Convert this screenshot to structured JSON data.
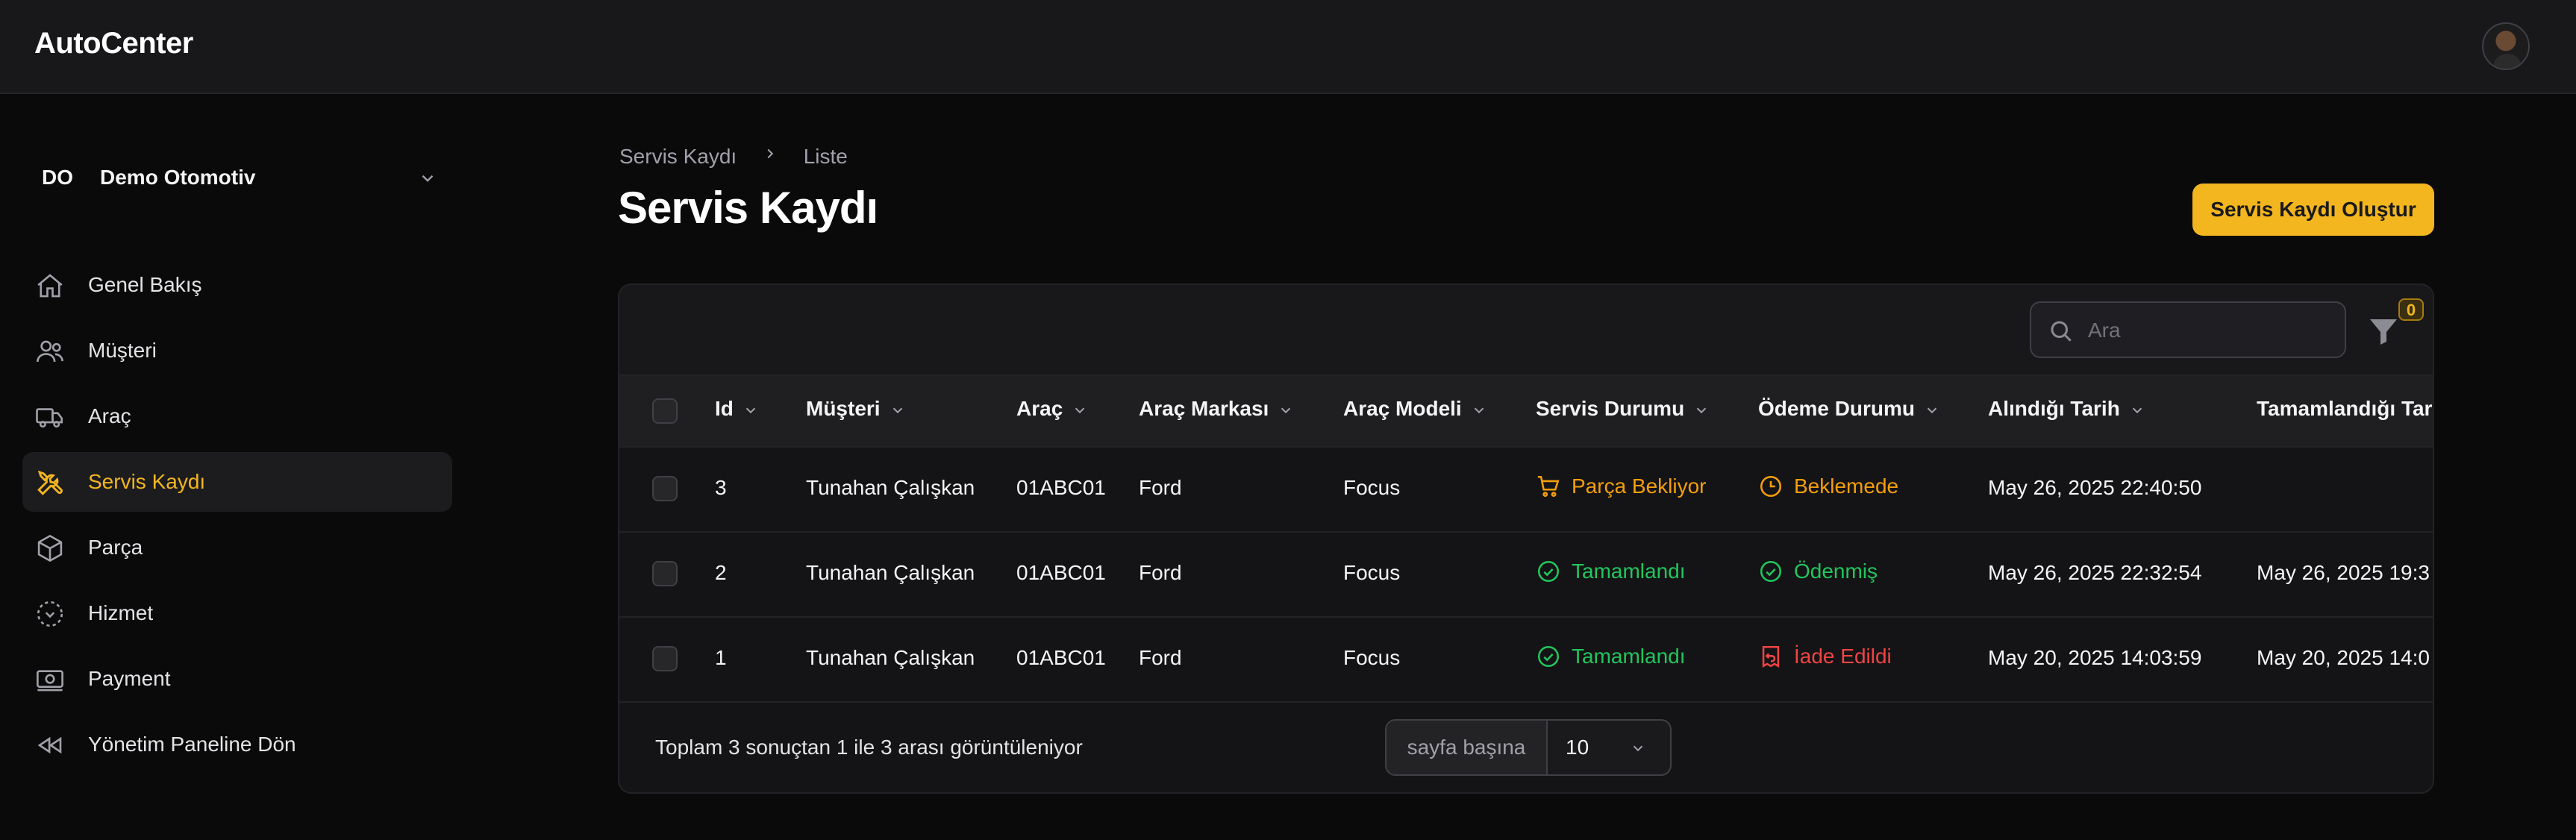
{
  "header": {
    "app_title": "AutoCenter"
  },
  "tenant": {
    "initials": "DO",
    "name": "Demo Otomotiv"
  },
  "sidebar": {
    "items": [
      {
        "label": "Genel Bakış",
        "icon": "home-icon"
      },
      {
        "label": "Müşteri",
        "icon": "users-icon"
      },
      {
        "label": "Araç",
        "icon": "truck-icon"
      },
      {
        "label": "Servis Kaydı",
        "icon": "wrench-screwdriver-icon",
        "active": true
      },
      {
        "label": "Parça",
        "icon": "cube-icon"
      },
      {
        "label": "Hizmet",
        "icon": "viewfinder-icon"
      },
      {
        "label": "Payment",
        "icon": "banknotes-icon"
      },
      {
        "label": "Yönetim Paneline Dön",
        "icon": "backward-icon"
      }
    ]
  },
  "breadcrumb": {
    "items": [
      "Servis Kaydı",
      "Liste"
    ]
  },
  "page": {
    "title": "Servis Kaydı",
    "create_button": "Servis Kaydı Oluştur"
  },
  "search": {
    "placeholder": "Ara",
    "value": ""
  },
  "filter": {
    "active_count": "0"
  },
  "table": {
    "columns": [
      "Id",
      "Müşteri",
      "Araç",
      "Araç Markası",
      "Araç Modeli",
      "Servis Durumu",
      "Ödeme Durumu",
      "Alındığı Tarih",
      "Tamamlandığı Tar"
    ],
    "rows": [
      {
        "id": "3",
        "customer": "Tunahan Çalışkan",
        "vehicle": "01ABC01",
        "brand": "Ford",
        "model": "Focus",
        "service_status": "Parça Bekliyor",
        "payment_status": "Beklemede",
        "received": "May 26, 2025 22:40:50",
        "completed": ""
      },
      {
        "id": "2",
        "customer": "Tunahan Çalışkan",
        "vehicle": "01ABC01",
        "brand": "Ford",
        "model": "Focus",
        "service_status": "Tamamlandı",
        "payment_status": "Ödenmiş",
        "received": "May 26, 2025 22:32:54",
        "completed": "May 26, 2025 19:3"
      },
      {
        "id": "1",
        "customer": "Tunahan Çalışkan",
        "vehicle": "01ABC01",
        "brand": "Ford",
        "model": "Focus",
        "service_status": "Tamamlandı",
        "payment_status": "İade Edildi",
        "received": "May 20, 2025 14:03:59",
        "completed": "May 20, 2025 14:0"
      }
    ]
  },
  "footer": {
    "summary": "Toplam 3 sonuçtan 1 ile 3 arası görüntüleniyor",
    "per_page_label": "sayfa başına",
    "per_page_value": "10"
  },
  "colors": {
    "accent": "#f3b61f",
    "success": "#22c55e",
    "warning": "#f59e0b",
    "danger": "#ef4444"
  }
}
